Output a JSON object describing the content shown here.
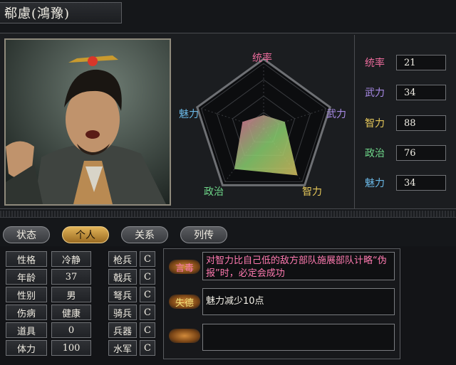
{
  "character": {
    "name": "郗慮(鴻豫)"
  },
  "radar": {
    "labels": {
      "top": "统率",
      "right": "武力",
      "bottom_right": "智力",
      "bottom_left": "政治",
      "left": "魅力"
    },
    "values": {
      "leadership": 21,
      "war": 34,
      "intelligence": 88,
      "politics": 76,
      "charm": 34
    },
    "max": 100
  },
  "stats": [
    {
      "label": "统率",
      "value": "21",
      "color": "#e86a9a"
    },
    {
      "label": "武力",
      "value": "34",
      "color": "#a88ae6"
    },
    {
      "label": "智力",
      "value": "88",
      "color": "#e6c85a"
    },
    {
      "label": "政治",
      "value": "76",
      "color": "#6fd88a"
    },
    {
      "label": "魅力",
      "value": "34",
      "color": "#6ab8e6"
    }
  ],
  "tabs": [
    {
      "label": "状态",
      "active": false
    },
    {
      "label": "个人",
      "active": true
    },
    {
      "label": "关系",
      "active": false
    },
    {
      "label": "列传",
      "active": false
    }
  ],
  "attributes": [
    {
      "key": "性格",
      "value": "冷静"
    },
    {
      "key": "年龄",
      "value": "37"
    },
    {
      "key": "性别",
      "value": "男"
    },
    {
      "key": "伤病",
      "value": "健康"
    },
    {
      "key": "道具",
      "value": "0"
    },
    {
      "key": "体力",
      "value": "100"
    }
  ],
  "units": [
    {
      "key": "枪兵",
      "value": "C"
    },
    {
      "key": "戟兵",
      "value": "C"
    },
    {
      "key": "弩兵",
      "value": "C"
    },
    {
      "key": "骑兵",
      "value": "C"
    },
    {
      "key": "兵器",
      "value": "C"
    },
    {
      "key": "水军",
      "value": "C"
    }
  ],
  "skills": [
    {
      "tag": "言毒",
      "text": "对智力比自己低的敌方部队施展部队计略“伪报”时，必定会成功",
      "tag_color": "#ff7ab0",
      "text_color": "#ff7ab0"
    },
    {
      "tag": "失德",
      "text": "魅力减少10点",
      "tag_color": "#f2e27a",
      "text_color": "#f2efe6"
    },
    {
      "tag": "",
      "text": "",
      "tag_color": "#f2efe6",
      "text_color": "#f2efe6"
    }
  ]
}
